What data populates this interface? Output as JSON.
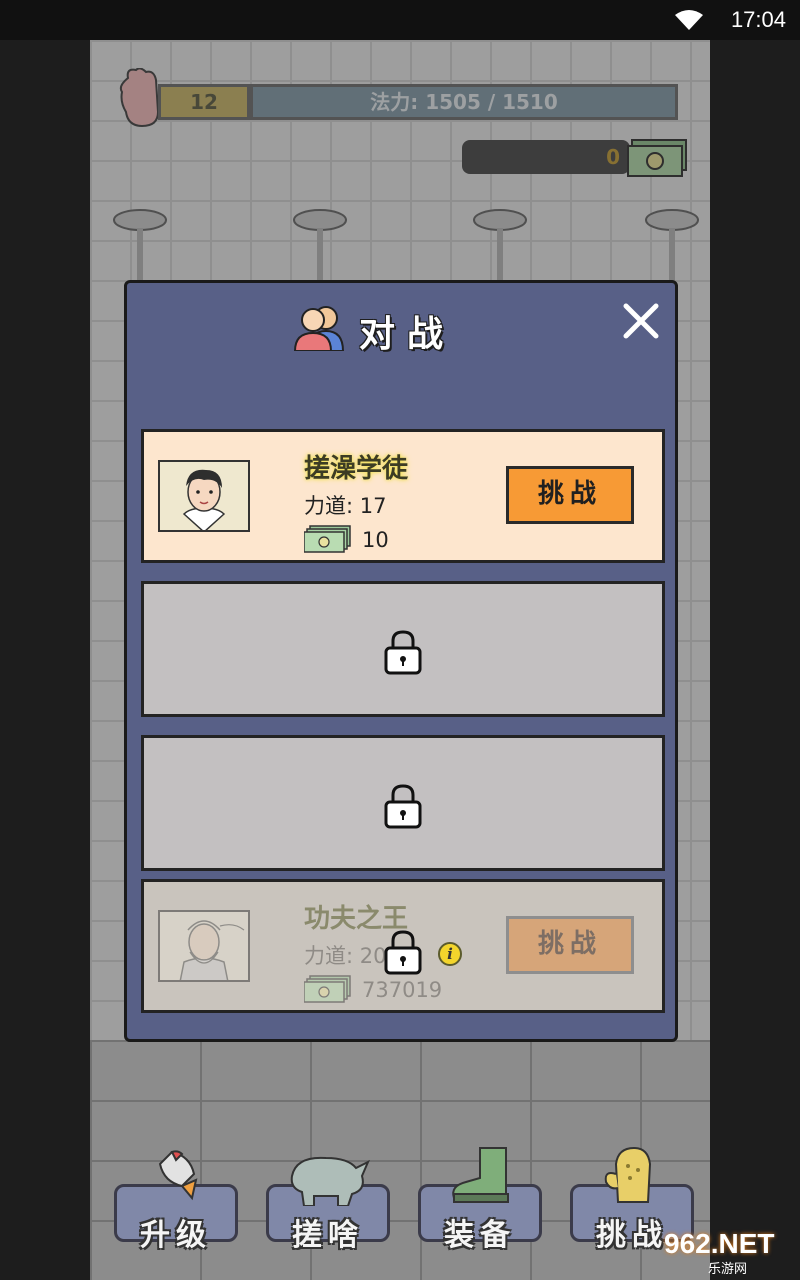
{
  "status_bar": {
    "time": "17:04"
  },
  "hud": {
    "level": "12",
    "mana": "法力: 1505 / 1510",
    "money": "0"
  },
  "modal": {
    "title": "对战",
    "slots": [
      {
        "name": "搓澡学徒",
        "power": "力道: 17",
        "reward": "10",
        "button": "挑战",
        "locked": false
      },
      {
        "locked": true
      },
      {
        "locked": true
      },
      {
        "name": "功夫之王",
        "power": "力道: 20",
        "reward": "737019",
        "button": "挑战",
        "locked": true
      }
    ]
  },
  "nav": [
    {
      "label": "升级",
      "icon": "rocket-icon"
    },
    {
      "label": "搓啥",
      "icon": "rhino-icon"
    },
    {
      "label": "装备",
      "icon": "boot-icon"
    },
    {
      "label": "挑战",
      "icon": "glove-icon"
    }
  ],
  "watermark": {
    "brand": "962.NET",
    "sub": "乐游网"
  },
  "colors": {
    "modal_bg": "#586087",
    "active_slot": "#fde6ce",
    "locked_slot": "#c3c0c1",
    "challenge_button": "#f79a35"
  }
}
